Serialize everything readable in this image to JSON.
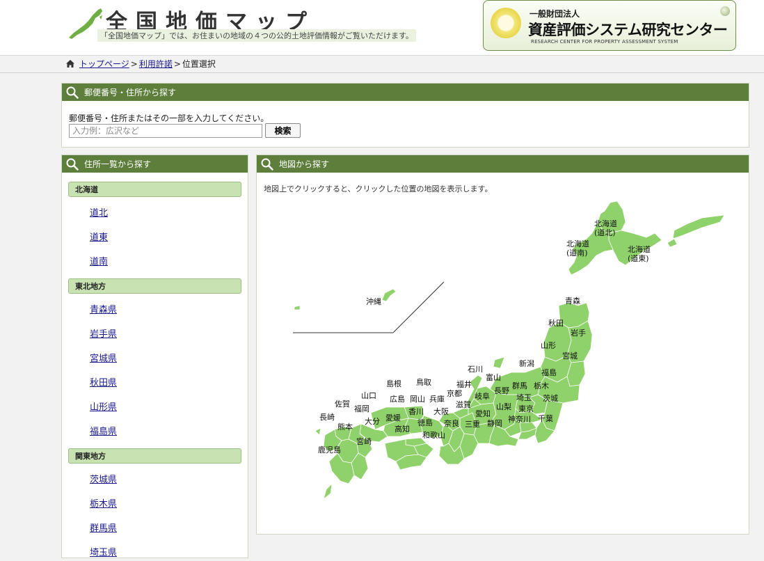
{
  "header": {
    "site_title": "全国地価マップ",
    "tagline": "「全国地価マップ」では、お住まいの地域の４つの公的土地評価情報がご覧いただけます。",
    "org_small": "一般財団法人",
    "org_name": "資産評価システム研究センター",
    "org_en": "RESEARCH CENTER FOR PROPERTY ASSESSMENT SYSTEM"
  },
  "breadcrumb": {
    "items": [
      "トップページ",
      "利用許諾"
    ],
    "sep": ">",
    "current": "位置選択"
  },
  "postal": {
    "title": "郵便番号・住所から探す",
    "description": "郵便番号・住所またはその一部を入力してください。",
    "placeholder": "入力例：広沢など",
    "button": "検索"
  },
  "address_list": {
    "title": "住所一覧から探す",
    "regions": [
      {
        "name": "北海道",
        "prefs": [
          "道北",
          "道東",
          "道南"
        ]
      },
      {
        "name": "東北地方",
        "prefs": [
          "青森県",
          "岩手県",
          "宮城県",
          "秋田県",
          "山形県",
          "福島県"
        ]
      },
      {
        "name": "関東地方",
        "prefs": [
          "茨城県",
          "栃木県",
          "群馬県",
          "埼玉県"
        ]
      }
    ]
  },
  "map_panel": {
    "title": "地図から探す",
    "description": "地図上でクリックすると、クリックした位置の地図を表示します。",
    "color": "#8fd16a",
    "labels": {
      "dohoku": [
        "北海道",
        "(道北)"
      ],
      "donan": [
        "北海道",
        "(道南)"
      ],
      "doto": [
        "北海道",
        "(道東)"
      ],
      "okinawa": "沖縄",
      "aomori": "青森",
      "akita": "秋田",
      "iwate": "岩手",
      "yamagata": "山形",
      "miyagi": "宮城",
      "niigata": "新潟",
      "fukushima": "福島",
      "ishikawa": "石川",
      "toyama": "富山",
      "gunma": "群馬",
      "tochigi": "栃木",
      "ibaraki": "茨城",
      "nagano": "長野",
      "saitama": "埼玉",
      "fukui": "福井",
      "gifu": "岐阜",
      "yamanashi": "山梨",
      "tokyo": "東京",
      "chiba": "千葉",
      "kanagawa": "神奈川",
      "shizuoka": "静岡",
      "aichi": "愛知",
      "mie": "三重",
      "shiga": "滋賀",
      "kyoto": "京都",
      "nara": "奈良",
      "osaka": "大阪",
      "hyogo": "兵庫",
      "wakayama": "和歌山",
      "tottori": "鳥取",
      "shimane": "島根",
      "okayama": "岡山",
      "hiroshima": "広島",
      "yamaguchi": "山口",
      "kagawa": "香川",
      "tokushima": "徳島",
      "ehime": "愛媛",
      "kochi": "高知",
      "fukuoka": "福岡",
      "saga": "佐賀",
      "nagasaki": "長崎",
      "oita": "大分",
      "kumamoto": "熊本",
      "miyazaki": "宮崎",
      "kagoshima": "鹿児島"
    }
  }
}
